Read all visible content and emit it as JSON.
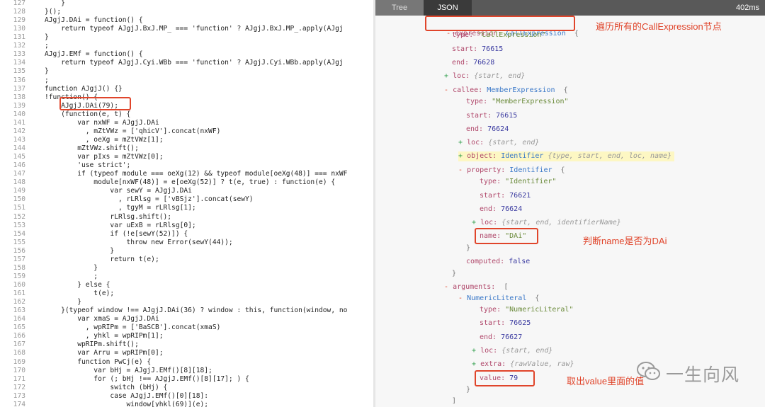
{
  "editor": {
    "lines": [
      {
        "n": "127",
        "code": "    }"
      },
      {
        "n": "128",
        "code": "}();"
      },
      {
        "n": "129",
        "code": "AJgjJ.DAi = function() {"
      },
      {
        "n": "130",
        "code": "    return typeof AJgjJ.BxJ.MP_ === 'function' ? AJgjJ.BxJ.MP_.apply(AJgj"
      },
      {
        "n": "131",
        "code": "}"
      },
      {
        "n": "132",
        "code": ";"
      },
      {
        "n": "133",
        "code": "AJgjJ.EMf = function() {"
      },
      {
        "n": "134",
        "code": "    return typeof AJgjJ.Cyi.WBb === 'function' ? AJgjJ.Cyi.WBb.apply(AJgj"
      },
      {
        "n": "135",
        "code": "}"
      },
      {
        "n": "136",
        "code": ";"
      },
      {
        "n": "137",
        "code": "function AJgjJ() {}"
      },
      {
        "n": "138",
        "code": "!function() {"
      },
      {
        "n": "139",
        "code": "    AJgjJ.DAi(79);"
      },
      {
        "n": "140",
        "code": "    (function(e, t) {"
      },
      {
        "n": "141",
        "code": "        var nxWF = AJgjJ.DAi"
      },
      {
        "n": "142",
        "code": "          , mZtVWz = ['qhicV'].concat(nxWF)"
      },
      {
        "n": "143",
        "code": "          , oeXg = mZtVWz[1];"
      },
      {
        "n": "144",
        "code": "        mZtVWz.shift();"
      },
      {
        "n": "145",
        "code": "        var pIxs = mZtVWz[0];"
      },
      {
        "n": "146",
        "code": "        'use strict';"
      },
      {
        "n": "147",
        "code": "        if (typeof module === oeXg(12) && typeof module[oeXg(48)] === nxWF"
      },
      {
        "n": "148",
        "code": "            module[nxWF(48)] = e[oeXg(52)] ? t(e, true) : function(e) {"
      },
      {
        "n": "149",
        "code": "                var sewY = AJgjJ.DAi"
      },
      {
        "n": "150",
        "code": "                  , rLRlsg = ['vBSjz'].concat(sewY)"
      },
      {
        "n": "151",
        "code": "                  , tgyM = rLRlsg[1];"
      },
      {
        "n": "152",
        "code": "                rLRlsg.shift();"
      },
      {
        "n": "153",
        "code": "                var uExB = rLRlsg[0];"
      },
      {
        "n": "154",
        "code": "                if (!e[sewY(52)]) {"
      },
      {
        "n": "155",
        "code": "                    throw new Error(sewY(44));"
      },
      {
        "n": "156",
        "code": "                }"
      },
      {
        "n": "157",
        "code": "                return t(e);"
      },
      {
        "n": "158",
        "code": "            }"
      },
      {
        "n": "159",
        "code": "            ;"
      },
      {
        "n": "160",
        "code": "        } else {"
      },
      {
        "n": "161",
        "code": "            t(e);"
      },
      {
        "n": "162",
        "code": "        }"
      },
      {
        "n": "163",
        "code": "    }(typeof window !== AJgjJ.DAi(36) ? window : this, function(window, no"
      },
      {
        "n": "164",
        "code": "        var xmaS = AJgjJ.DAi"
      },
      {
        "n": "165",
        "code": "          , wpRIPm = ['BaSCB'].concat(xmaS)"
      },
      {
        "n": "166",
        "code": "          , yhkl = wpRIPm[1];"
      },
      {
        "n": "167",
        "code": "        wpRIPm.shift();"
      },
      {
        "n": "168",
        "code": "        var Arru = wpRIPm[0];"
      },
      {
        "n": "169",
        "code": "        function PwCj(e) {"
      },
      {
        "n": "170",
        "code": "            var bHj = AJgjJ.EMf()[8][18];"
      },
      {
        "n": "171",
        "code": "            for (; bHj !== AJgjJ.EMf()[8][17]; ) {"
      },
      {
        "n": "172",
        "code": "                switch (bHj) {"
      },
      {
        "n": "173",
        "code": "                case AJgjJ.EMf()[0][18]:"
      },
      {
        "n": "174",
        "code": "                    window[yhkl(69)](e);"
      }
    ]
  },
  "ast_panel": {
    "tabs": {
      "tree": "Tree",
      "json": "JSON"
    },
    "timing": "402ms",
    "nodes": {
      "expression": {
        "toggle": "-",
        "key": "expression:",
        "type": "CallExpression",
        "brace": "{"
      },
      "type1": {
        "key": "type:",
        "value": "\"CallExpression\""
      },
      "start1": {
        "key": "start:",
        "value": "76615"
      },
      "end1": {
        "key": "end:",
        "value": "76628"
      },
      "loc1": {
        "toggle": "+",
        "key": "loc:",
        "summary": "{start, end}"
      },
      "callee": {
        "toggle": "-",
        "key": "callee:",
        "type": "MemberExpression",
        "brace": "{"
      },
      "type2": {
        "key": "type:",
        "value": "\"MemberExpression\""
      },
      "start2": {
        "key": "start:",
        "value": "76615"
      },
      "end2": {
        "key": "end:",
        "value": "76624"
      },
      "loc2": {
        "toggle": "+",
        "key": "loc:",
        "summary": "{start, end}"
      },
      "object": {
        "toggle": "+",
        "key": "object:",
        "type": "Identifier",
        "summary": "{type, start, end, loc, name}"
      },
      "property": {
        "toggle": "-",
        "key": "property:",
        "type": "Identifier",
        "brace": "{"
      },
      "type3": {
        "key": "type:",
        "value": "\"Identifier\""
      },
      "start3": {
        "key": "start:",
        "value": "76621"
      },
      "end3": {
        "key": "end:",
        "value": "76624"
      },
      "loc3": {
        "toggle": "+",
        "key": "loc:",
        "summary": "{start, end, identifierName}"
      },
      "name": {
        "key": "name:",
        "value": "\"DAi\""
      },
      "close1": {
        "text": "}"
      },
      "computed": {
        "key": "computed:",
        "value": "false"
      },
      "close2": {
        "text": "}"
      },
      "arguments": {
        "toggle": "-",
        "key": "arguments:",
        "brace": "["
      },
      "numlit": {
        "toggle": "-",
        "type": "NumericLiteral",
        "brace": "{"
      },
      "type4": {
        "key": "type:",
        "value": "\"NumericLiteral\""
      },
      "start4": {
        "key": "start:",
        "value": "76625"
      },
      "end4": {
        "key": "end:",
        "value": "76627"
      },
      "loc4": {
        "toggle": "+",
        "key": "loc:",
        "summary": "{start, end}"
      },
      "extra": {
        "toggle": "+",
        "key": "extra:",
        "summary": "{rawValue, raw}"
      },
      "value": {
        "key": "value:",
        "value": "79"
      },
      "close3": {
        "text": "}"
      },
      "close4": {
        "text": "]"
      }
    },
    "annotations": {
      "expression_note": "遍历所有的CallExpression节点",
      "name_note": "判断name是否为DAi",
      "value_note": "取出value里面的值"
    },
    "watermark": "一生向风"
  }
}
